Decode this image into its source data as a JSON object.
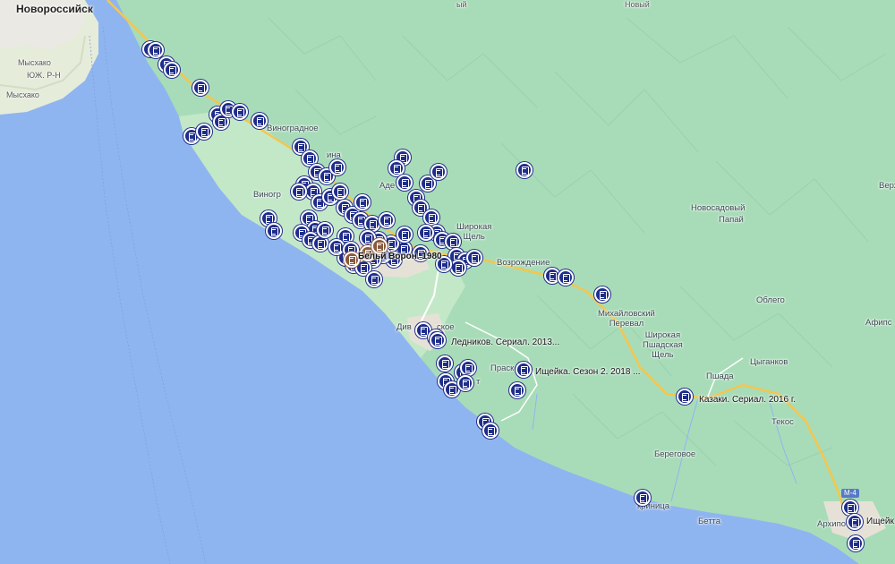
{
  "places": {
    "novorossiysk": "Новороссийск",
    "myskhako1": "Мысхако",
    "yuzh_rn": "ЮЖ. Р-Н",
    "myskhako2": "Мысхако",
    "vinogradnoe": "Виноградное",
    "vinogr_cut": "Виногр",
    "ina_cut": "ина",
    "adel_cut": "Аде",
    "shirokaya_shchel": "Широкая\nЩель",
    "vozrozhdenie": "Возрождение",
    "novosadovy": "Новосадовый",
    "papai": "Папай",
    "oblego": "Облего",
    "mikhailovsky": "Михайловский\nПеревал",
    "shirokaya_pshad": "Широкая\nПшадская\nЩель",
    "pshada": "Пшада",
    "tsygankov": "Цыганков",
    "afips": "Афипс",
    "tekos": "Текос",
    "beregovoe": "Береговое",
    "betta": "Бетта",
    "krinitsa_cut": "криница",
    "arkhipo": "Архипо",
    "diva_cut": "Див",
    "ske_cut": "ское",
    "praskov_cut": "Праско",
    "k_cut": "К",
    "t_cut": "т",
    "nyi_cut": "Новый",
    "top_cut": "ый",
    "verkh_cut": "Верх"
  },
  "films": {
    "belye_rosy": "Бельй Ворон. 1980",
    "lednikov": "Ледников. Сериал. 2013...",
    "ishcheyka2": "Ищейка. Сезон 2. 2018 ...",
    "kazaki": "Казаки. Сериал. 2016 г.",
    "ishcheyka_edge": "Ищейк"
  },
  "road_shield": "М-4",
  "colors": {
    "sea": "#8fb5f0",
    "land": "#a8dcb8",
    "marker": "#1f2d8a",
    "highlight_marker": "#8a5a3c",
    "road": "#f3c64f"
  },
  "icons": {
    "marker": "film-marker-icon",
    "highlight": "film-highlight-marker-icon"
  }
}
